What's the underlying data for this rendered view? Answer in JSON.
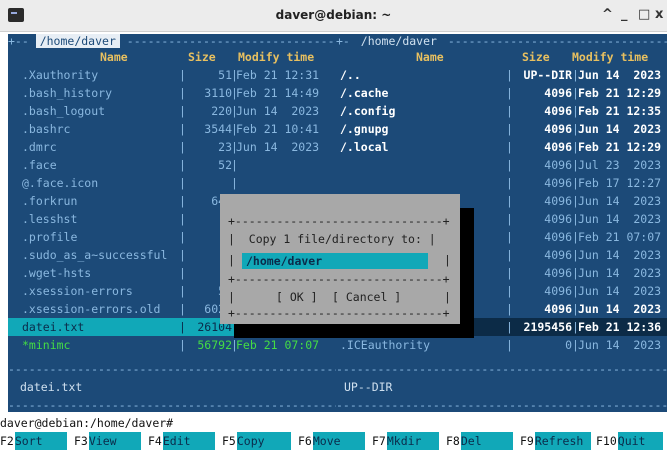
{
  "window": {
    "title": "daver@debian: ~",
    "buttons": [
      "^",
      "_",
      "□",
      "x"
    ]
  },
  "left_panel": {
    "path": "/home/daver",
    "columns": {
      "name": "Name",
      "size": "Size",
      "modify": "Modify time"
    },
    "files": [
      {
        "name": ".Xauthority",
        "size": "51",
        "time": "Feb 21 12:31"
      },
      {
        "name": ".bash_history",
        "size": "3110",
        "time": "Feb 21 14:49"
      },
      {
        "name": ".bash_logout",
        "size": "220",
        "time": "Jun 14  2023"
      },
      {
        "name": ".bashrc",
        "size": "3544",
        "time": "Feb 21 10:41"
      },
      {
        "name": ".dmrc",
        "size": "23",
        "time": "Jun 14  2023"
      },
      {
        "name": ".face",
        "size": "52",
        "time": ""
      },
      {
        "name": "@.face.icon",
        "size": "",
        "time": ""
      },
      {
        "name": ".forkrun",
        "size": "646",
        "time": ""
      },
      {
        "name": ".lesshst",
        "size": "",
        "time": ""
      },
      {
        "name": ".profile",
        "size": "8",
        "time": ""
      },
      {
        "name": ".sudo_as_a~successful",
        "size": "",
        "time": ""
      },
      {
        "name": ".wget-hsts",
        "size": "2",
        "time": ""
      },
      {
        "name": ".xsession-errors",
        "size": "56",
        "time": ""
      },
      {
        "name": ".xsession-errors.old",
        "size": "6021",
        "time": "Feb 21 12:30"
      },
      {
        "name": "datei.txt",
        "size": "26104",
        "time": "Feb 21 14:51"
      },
      {
        "name": "*minimc",
        "size": "56792",
        "time": "Feb 21 07:07"
      }
    ],
    "status": "datei.txt"
  },
  "right_panel": {
    "path": "/home/daver",
    "columns": {
      "name": "Name",
      "size": "Size",
      "modify": "Modify time"
    },
    "files": [
      {
        "name": "/..",
        "size": "UP--DIR",
        "time": "Jun 14  2023"
      },
      {
        "name": "/.cache",
        "size": "4096",
        "time": "Feb 21 12:29"
      },
      {
        "name": "/.config",
        "size": "4096",
        "time": "Feb 21 12:35"
      },
      {
        "name": "/.gnupg",
        "size": "4096",
        "time": "Jun 14  2023"
      },
      {
        "name": "/.local",
        "size": "4096",
        "time": "Feb 21 12:29"
      },
      {
        "name": "",
        "size": "4096",
        "time": "Jul 23  2023"
      },
      {
        "name": "",
        "size": "4096",
        "time": "Feb 17 12:27"
      },
      {
        "name": "",
        "size": "4096",
        "time": "Jun 14  2023"
      },
      {
        "name": "",
        "size": "4096",
        "time": "Jun 14  2023"
      },
      {
        "name": "",
        "size": "4096",
        "time": "Feb 21 07:07"
      },
      {
        "name": "",
        "size": "4096",
        "time": "Jun 14  2023"
      },
      {
        "name": "",
        "size": "4096",
        "time": "Jun 14  2023"
      },
      {
        "name": "",
        "size": "4096",
        "time": "Jun 14  2023"
      },
      {
        "name": "/Vorlagen",
        "size": "4096",
        "time": "Jun 14  2023"
      },
      {
        "name": "/tmp",
        "size": "2195456",
        "time": "Feb 21 12:36"
      },
      {
        "name": ".ICEauthority",
        "size": "0",
        "time": "Jun 14  2023"
      }
    ],
    "status": "UP--DIR"
  },
  "dialog": {
    "prompt": "Copy 1 file/directory to:",
    "target": "/home/daver",
    "ok": "[ OK ]",
    "cancel": "[ Cancel ]"
  },
  "command_line": "daver@debian:/home/daver#",
  "fkeys": [
    {
      "n": "F2",
      "label": "Sort"
    },
    {
      "n": "F3",
      "label": "View"
    },
    {
      "n": "F4",
      "label": "Edit"
    },
    {
      "n": "F5",
      "label": "Copy"
    },
    {
      "n": "F6",
      "label": "Move"
    },
    {
      "n": "F7",
      "label": "Mkdir"
    },
    {
      "n": "F8",
      "label": "Del"
    },
    {
      "n": "F9",
      "label": "Refresh"
    },
    {
      "n": "F10",
      "label": "Quit"
    }
  ]
}
